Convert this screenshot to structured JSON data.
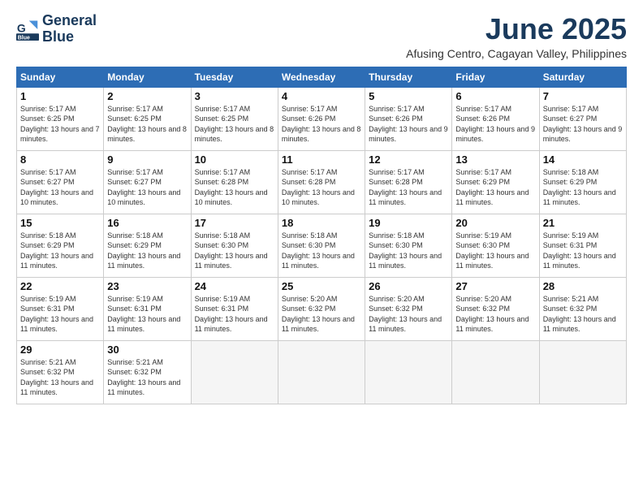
{
  "logo": {
    "line1": "General",
    "line2": "Blue"
  },
  "title": "June 2025",
  "subtitle": "Afusing Centro, Cagayan Valley, Philippines",
  "days_of_week": [
    "Sunday",
    "Monday",
    "Tuesday",
    "Wednesday",
    "Thursday",
    "Friday",
    "Saturday"
  ],
  "weeks": [
    [
      {
        "day": 1,
        "info": "Sunrise: 5:17 AM\nSunset: 6:25 PM\nDaylight: 13 hours\nand 7 minutes."
      },
      {
        "day": 2,
        "info": "Sunrise: 5:17 AM\nSunset: 6:25 PM\nDaylight: 13 hours\nand 8 minutes."
      },
      {
        "day": 3,
        "info": "Sunrise: 5:17 AM\nSunset: 6:25 PM\nDaylight: 13 hours\nand 8 minutes."
      },
      {
        "day": 4,
        "info": "Sunrise: 5:17 AM\nSunset: 6:26 PM\nDaylight: 13 hours\nand 8 minutes."
      },
      {
        "day": 5,
        "info": "Sunrise: 5:17 AM\nSunset: 6:26 PM\nDaylight: 13 hours\nand 9 minutes."
      },
      {
        "day": 6,
        "info": "Sunrise: 5:17 AM\nSunset: 6:26 PM\nDaylight: 13 hours\nand 9 minutes."
      },
      {
        "day": 7,
        "info": "Sunrise: 5:17 AM\nSunset: 6:27 PM\nDaylight: 13 hours\nand 9 minutes."
      }
    ],
    [
      {
        "day": 8,
        "info": "Sunrise: 5:17 AM\nSunset: 6:27 PM\nDaylight: 13 hours\nand 10 minutes."
      },
      {
        "day": 9,
        "info": "Sunrise: 5:17 AM\nSunset: 6:27 PM\nDaylight: 13 hours\nand 10 minutes."
      },
      {
        "day": 10,
        "info": "Sunrise: 5:17 AM\nSunset: 6:28 PM\nDaylight: 13 hours\nand 10 minutes."
      },
      {
        "day": 11,
        "info": "Sunrise: 5:17 AM\nSunset: 6:28 PM\nDaylight: 13 hours\nand 10 minutes."
      },
      {
        "day": 12,
        "info": "Sunrise: 5:17 AM\nSunset: 6:28 PM\nDaylight: 13 hours\nand 11 minutes."
      },
      {
        "day": 13,
        "info": "Sunrise: 5:17 AM\nSunset: 6:29 PM\nDaylight: 13 hours\nand 11 minutes."
      },
      {
        "day": 14,
        "info": "Sunrise: 5:18 AM\nSunset: 6:29 PM\nDaylight: 13 hours\nand 11 minutes."
      }
    ],
    [
      {
        "day": 15,
        "info": "Sunrise: 5:18 AM\nSunset: 6:29 PM\nDaylight: 13 hours\nand 11 minutes."
      },
      {
        "day": 16,
        "info": "Sunrise: 5:18 AM\nSunset: 6:29 PM\nDaylight: 13 hours\nand 11 minutes."
      },
      {
        "day": 17,
        "info": "Sunrise: 5:18 AM\nSunset: 6:30 PM\nDaylight: 13 hours\nand 11 minutes."
      },
      {
        "day": 18,
        "info": "Sunrise: 5:18 AM\nSunset: 6:30 PM\nDaylight: 13 hours\nand 11 minutes."
      },
      {
        "day": 19,
        "info": "Sunrise: 5:18 AM\nSunset: 6:30 PM\nDaylight: 13 hours\nand 11 minutes."
      },
      {
        "day": 20,
        "info": "Sunrise: 5:19 AM\nSunset: 6:30 PM\nDaylight: 13 hours\nand 11 minutes."
      },
      {
        "day": 21,
        "info": "Sunrise: 5:19 AM\nSunset: 6:31 PM\nDaylight: 13 hours\nand 11 minutes."
      }
    ],
    [
      {
        "day": 22,
        "info": "Sunrise: 5:19 AM\nSunset: 6:31 PM\nDaylight: 13 hours\nand 11 minutes."
      },
      {
        "day": 23,
        "info": "Sunrise: 5:19 AM\nSunset: 6:31 PM\nDaylight: 13 hours\nand 11 minutes."
      },
      {
        "day": 24,
        "info": "Sunrise: 5:19 AM\nSunset: 6:31 PM\nDaylight: 13 hours\nand 11 minutes."
      },
      {
        "day": 25,
        "info": "Sunrise: 5:20 AM\nSunset: 6:32 PM\nDaylight: 13 hours\nand 11 minutes."
      },
      {
        "day": 26,
        "info": "Sunrise: 5:20 AM\nSunset: 6:32 PM\nDaylight: 13 hours\nand 11 minutes."
      },
      {
        "day": 27,
        "info": "Sunrise: 5:20 AM\nSunset: 6:32 PM\nDaylight: 13 hours\nand 11 minutes."
      },
      {
        "day": 28,
        "info": "Sunrise: 5:21 AM\nSunset: 6:32 PM\nDaylight: 13 hours\nand 11 minutes."
      }
    ],
    [
      {
        "day": 29,
        "info": "Sunrise: 5:21 AM\nSunset: 6:32 PM\nDaylight: 13 hours\nand 11 minutes."
      },
      {
        "day": 30,
        "info": "Sunrise: 5:21 AM\nSunset: 6:32 PM\nDaylight: 13 hours\nand 11 minutes."
      },
      {
        "day": null,
        "info": ""
      },
      {
        "day": null,
        "info": ""
      },
      {
        "day": null,
        "info": ""
      },
      {
        "day": null,
        "info": ""
      },
      {
        "day": null,
        "info": ""
      }
    ]
  ]
}
